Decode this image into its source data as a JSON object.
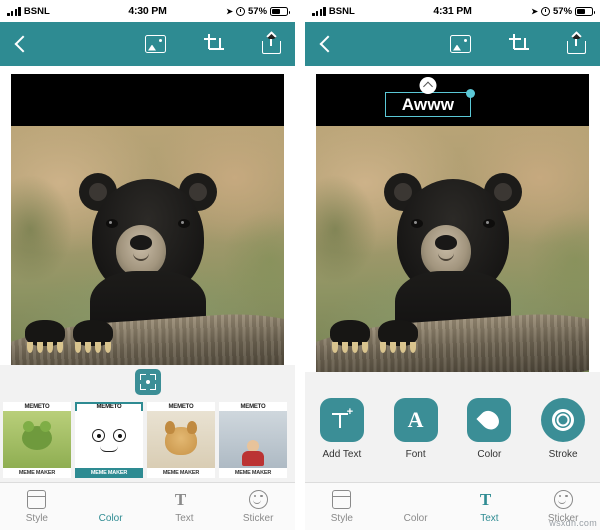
{
  "left_phone": {
    "status_bar": {
      "carrier": "BSNL",
      "time": "4:30 PM",
      "battery_percent": "57%",
      "signal_icon": "signal-bars-icon",
      "alarm_icon": "alarm-clock-icon",
      "location_icon": "location-arrow-icon",
      "battery_icon": "battery-icon"
    },
    "navbar": {
      "back_icon": "chevron-left-icon",
      "photo_icon": "image-picker-icon",
      "crop_icon": "crop-icon",
      "share_icon": "share-icon"
    },
    "frame_button": "frame-expand-icon",
    "templates": [
      {
        "top_label": "MEMETO",
        "bottom_label": "MEME MAKER",
        "art": "frog-art",
        "selected": false
      },
      {
        "top_label": "MEMETO",
        "bottom_label": "MEME MAKER",
        "art": "eyes-face-art",
        "selected": true
      },
      {
        "top_label": "MEMETO",
        "bottom_label": "MEME MAKER",
        "art": "doge-art",
        "selected": false
      },
      {
        "top_label": "MEMETO",
        "bottom_label": "MEME MAKER",
        "art": "man-art",
        "selected": false
      }
    ],
    "tabbar": [
      {
        "label": "Style",
        "icon": "style-icon",
        "active": false
      },
      {
        "label": "Color",
        "icon": "color-drop-icon",
        "active": true
      },
      {
        "label": "Text",
        "icon": "text-icon",
        "active": false
      },
      {
        "label": "Sticker",
        "icon": "sticker-smiley-icon",
        "active": false
      }
    ]
  },
  "right_phone": {
    "status_bar": {
      "carrier": "BSNL",
      "time": "4:31 PM",
      "battery_percent": "57%",
      "signal_icon": "signal-bars-icon",
      "alarm_icon": "alarm-clock-icon",
      "location_icon": "location-arrow-icon",
      "battery_icon": "battery-icon"
    },
    "navbar": {
      "back_icon": "chevron-left-icon",
      "photo_icon": "image-picker-icon",
      "crop_icon": "crop-icon",
      "share_icon": "share-icon"
    },
    "text_overlay": {
      "value": "Awww",
      "rotate_handle_icon": "rotate-handle-icon",
      "resize_handle_icon": "resize-handle-icon"
    },
    "tools": [
      {
        "label": "Add Text",
        "icon": "add-text-icon",
        "shape": "rounded"
      },
      {
        "label": "Font",
        "icon": "font-icon",
        "shape": "rounded"
      },
      {
        "label": "Color",
        "icon": "color-drop-icon",
        "shape": "rounded"
      },
      {
        "label": "Stroke",
        "icon": "stroke-ring-icon",
        "shape": "circle"
      }
    ],
    "tabbar": [
      {
        "label": "Style",
        "icon": "style-icon",
        "active": false
      },
      {
        "label": "Color",
        "icon": "color-drop-icon",
        "active": false
      },
      {
        "label": "Text",
        "icon": "text-icon",
        "active": true
      },
      {
        "label": "Sticker",
        "icon": "sticker-smiley-icon",
        "active": false
      }
    ]
  },
  "watermark": "wsxdn.com",
  "colors": {
    "teal": "#2e8b92",
    "tool_teal": "#3b8e96",
    "selection": "#5bc8d6",
    "inactive_tab": "#8a8a8a"
  }
}
